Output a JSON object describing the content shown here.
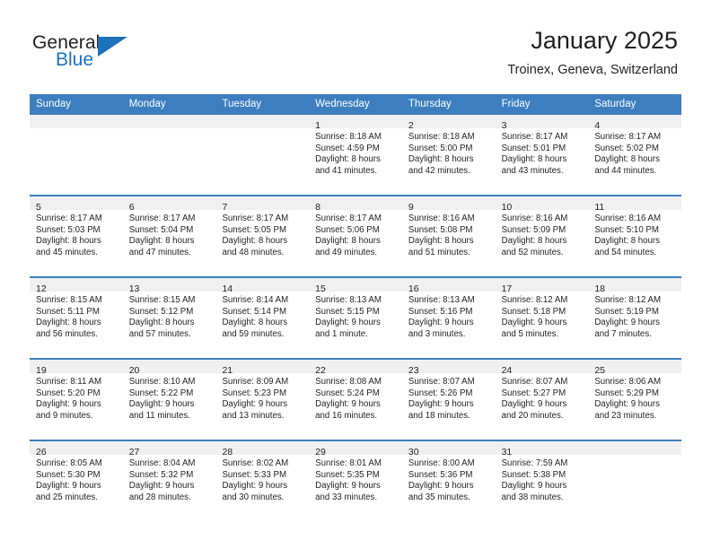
{
  "brand": {
    "name_top": "General",
    "name_bottom": "Blue",
    "flag_icon": "triangle-flag-icon",
    "accent_color": "#1c72bb"
  },
  "header": {
    "title": "January 2025",
    "subtitle": "Troinex, Geneva, Switzerland"
  },
  "calendar": {
    "header_bg": "#3c7ebf",
    "daynum_bg": "#f0f0f0",
    "weekdays": [
      "Sunday",
      "Monday",
      "Tuesday",
      "Wednesday",
      "Thursday",
      "Friday",
      "Saturday"
    ],
    "weeks": [
      [
        {
          "day": "",
          "lines": []
        },
        {
          "day": "",
          "lines": []
        },
        {
          "day": "",
          "lines": []
        },
        {
          "day": "1",
          "lines": [
            "Sunrise: 8:18 AM",
            "Sunset: 4:59 PM",
            "Daylight: 8 hours",
            "and 41 minutes."
          ]
        },
        {
          "day": "2",
          "lines": [
            "Sunrise: 8:18 AM",
            "Sunset: 5:00 PM",
            "Daylight: 8 hours",
            "and 42 minutes."
          ]
        },
        {
          "day": "3",
          "lines": [
            "Sunrise: 8:17 AM",
            "Sunset: 5:01 PM",
            "Daylight: 8 hours",
            "and 43 minutes."
          ]
        },
        {
          "day": "4",
          "lines": [
            "Sunrise: 8:17 AM",
            "Sunset: 5:02 PM",
            "Daylight: 8 hours",
            "and 44 minutes."
          ]
        }
      ],
      [
        {
          "day": "5",
          "lines": [
            "Sunrise: 8:17 AM",
            "Sunset: 5:03 PM",
            "Daylight: 8 hours",
            "and 45 minutes."
          ]
        },
        {
          "day": "6",
          "lines": [
            "Sunrise: 8:17 AM",
            "Sunset: 5:04 PM",
            "Daylight: 8 hours",
            "and 47 minutes."
          ]
        },
        {
          "day": "7",
          "lines": [
            "Sunrise: 8:17 AM",
            "Sunset: 5:05 PM",
            "Daylight: 8 hours",
            "and 48 minutes."
          ]
        },
        {
          "day": "8",
          "lines": [
            "Sunrise: 8:17 AM",
            "Sunset: 5:06 PM",
            "Daylight: 8 hours",
            "and 49 minutes."
          ]
        },
        {
          "day": "9",
          "lines": [
            "Sunrise: 8:16 AM",
            "Sunset: 5:08 PM",
            "Daylight: 8 hours",
            "and 51 minutes."
          ]
        },
        {
          "day": "10",
          "lines": [
            "Sunrise: 8:16 AM",
            "Sunset: 5:09 PM",
            "Daylight: 8 hours",
            "and 52 minutes."
          ]
        },
        {
          "day": "11",
          "lines": [
            "Sunrise: 8:16 AM",
            "Sunset: 5:10 PM",
            "Daylight: 8 hours",
            "and 54 minutes."
          ]
        }
      ],
      [
        {
          "day": "12",
          "lines": [
            "Sunrise: 8:15 AM",
            "Sunset: 5:11 PM",
            "Daylight: 8 hours",
            "and 56 minutes."
          ]
        },
        {
          "day": "13",
          "lines": [
            "Sunrise: 8:15 AM",
            "Sunset: 5:12 PM",
            "Daylight: 8 hours",
            "and 57 minutes."
          ]
        },
        {
          "day": "14",
          "lines": [
            "Sunrise: 8:14 AM",
            "Sunset: 5:14 PM",
            "Daylight: 8 hours",
            "and 59 minutes."
          ]
        },
        {
          "day": "15",
          "lines": [
            "Sunrise: 8:13 AM",
            "Sunset: 5:15 PM",
            "Daylight: 9 hours",
            "and 1 minute."
          ]
        },
        {
          "day": "16",
          "lines": [
            "Sunrise: 8:13 AM",
            "Sunset: 5:16 PM",
            "Daylight: 9 hours",
            "and 3 minutes."
          ]
        },
        {
          "day": "17",
          "lines": [
            "Sunrise: 8:12 AM",
            "Sunset: 5:18 PM",
            "Daylight: 9 hours",
            "and 5 minutes."
          ]
        },
        {
          "day": "18",
          "lines": [
            "Sunrise: 8:12 AM",
            "Sunset: 5:19 PM",
            "Daylight: 9 hours",
            "and 7 minutes."
          ]
        }
      ],
      [
        {
          "day": "19",
          "lines": [
            "Sunrise: 8:11 AM",
            "Sunset: 5:20 PM",
            "Daylight: 9 hours",
            "and 9 minutes."
          ]
        },
        {
          "day": "20",
          "lines": [
            "Sunrise: 8:10 AM",
            "Sunset: 5:22 PM",
            "Daylight: 9 hours",
            "and 11 minutes."
          ]
        },
        {
          "day": "21",
          "lines": [
            "Sunrise: 8:09 AM",
            "Sunset: 5:23 PM",
            "Daylight: 9 hours",
            "and 13 minutes."
          ]
        },
        {
          "day": "22",
          "lines": [
            "Sunrise: 8:08 AM",
            "Sunset: 5:24 PM",
            "Daylight: 9 hours",
            "and 16 minutes."
          ]
        },
        {
          "day": "23",
          "lines": [
            "Sunrise: 8:07 AM",
            "Sunset: 5:26 PM",
            "Daylight: 9 hours",
            "and 18 minutes."
          ]
        },
        {
          "day": "24",
          "lines": [
            "Sunrise: 8:07 AM",
            "Sunset: 5:27 PM",
            "Daylight: 9 hours",
            "and 20 minutes."
          ]
        },
        {
          "day": "25",
          "lines": [
            "Sunrise: 8:06 AM",
            "Sunset: 5:29 PM",
            "Daylight: 9 hours",
            "and 23 minutes."
          ]
        }
      ],
      [
        {
          "day": "26",
          "lines": [
            "Sunrise: 8:05 AM",
            "Sunset: 5:30 PM",
            "Daylight: 9 hours",
            "and 25 minutes."
          ]
        },
        {
          "day": "27",
          "lines": [
            "Sunrise: 8:04 AM",
            "Sunset: 5:32 PM",
            "Daylight: 9 hours",
            "and 28 minutes."
          ]
        },
        {
          "day": "28",
          "lines": [
            "Sunrise: 8:02 AM",
            "Sunset: 5:33 PM",
            "Daylight: 9 hours",
            "and 30 minutes."
          ]
        },
        {
          "day": "29",
          "lines": [
            "Sunrise: 8:01 AM",
            "Sunset: 5:35 PM",
            "Daylight: 9 hours",
            "and 33 minutes."
          ]
        },
        {
          "day": "30",
          "lines": [
            "Sunrise: 8:00 AM",
            "Sunset: 5:36 PM",
            "Daylight: 9 hours",
            "and 35 minutes."
          ]
        },
        {
          "day": "31",
          "lines": [
            "Sunrise: 7:59 AM",
            "Sunset: 5:38 PM",
            "Daylight: 9 hours",
            "and 38 minutes."
          ]
        },
        {
          "day": "",
          "lines": []
        }
      ]
    ]
  }
}
